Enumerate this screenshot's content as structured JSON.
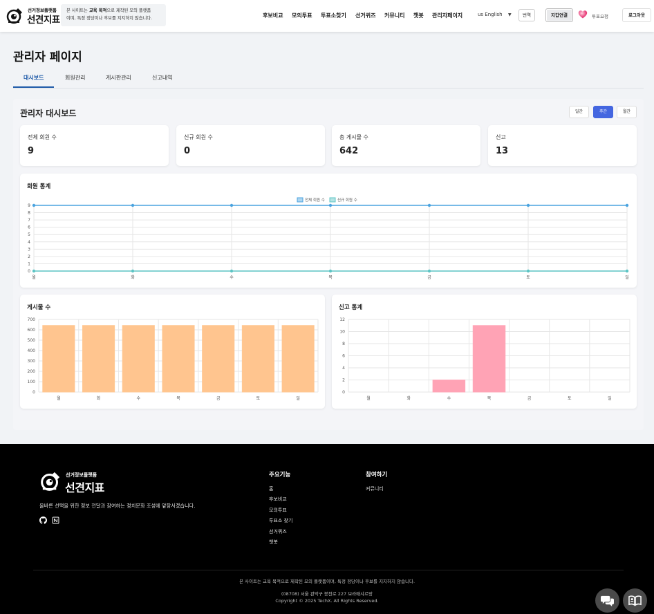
{
  "header": {
    "logo_small": "선거정보플랫폼",
    "logo_big": "선견지표",
    "notice_pre": "본 사이트는 ",
    "notice_bold": "교육 목적",
    "notice_post": "으로 제작된 모의 플랫폼",
    "notice_line2": "이며, 특정 정당이나 후보를 지지하지 않습니다.",
    "nav": [
      "후보비교",
      "모의투표",
      "투표소찾기",
      "선거퀴즈",
      "커뮤니티",
      "챗봇",
      "관리자페이지"
    ],
    "language": "us English",
    "translate_label": "번역",
    "wallet_label": "지갑연결",
    "vote_request_label": "투표요청",
    "logout_label": "로그아웃"
  },
  "page": {
    "title": "관리자 페이지",
    "tabs": [
      "대시보드",
      "회원관리",
      "게시판관리",
      "신고내역"
    ],
    "active_tab": "대시보드"
  },
  "dashboard": {
    "title": "관리자 대시보드",
    "periods": [
      "일간",
      "주간",
      "월간"
    ],
    "active_period": "주간",
    "stats": [
      {
        "label": "전체 회원 수",
        "value": "9"
      },
      {
        "label": "신규 회원 수",
        "value": "0"
      },
      {
        "label": "총 게시물 수",
        "value": "642"
      },
      {
        "label": "신고",
        "value": "13"
      }
    ]
  },
  "charts": {
    "members_title": "회원 통계",
    "posts_title": "게시물 수",
    "reports_title": "신고 통계"
  },
  "chart_data": [
    {
      "type": "line",
      "title": "회원 통계",
      "x": [
        "월",
        "화",
        "수",
        "목",
        "금",
        "토",
        "일"
      ],
      "series": [
        {
          "name": "전체 회원 수",
          "values": [
            9,
            9,
            9,
            9,
            9,
            9,
            9
          ],
          "color": "#4aa3df"
        },
        {
          "name": "신규 회원 수",
          "values": [
            0,
            0,
            0,
            0,
            0,
            0,
            0
          ],
          "color": "#5cc4c4"
        }
      ],
      "ylim": [
        0,
        9
      ],
      "yticks": [
        0,
        1,
        2,
        3,
        4,
        5,
        6,
        7,
        8,
        9
      ],
      "grid": true,
      "legend": "top-center"
    },
    {
      "type": "bar",
      "title": "게시물 수",
      "categories": [
        "월",
        "화",
        "수",
        "목",
        "금",
        "토",
        "일"
      ],
      "values": [
        642,
        642,
        642,
        642,
        642,
        642,
        642
      ],
      "ylim": [
        0,
        700
      ],
      "yticks": [
        0,
        100,
        200,
        300,
        400,
        500,
        600,
        700
      ],
      "color": "#ffc58f",
      "grid": true
    },
    {
      "type": "bar",
      "title": "신고 통계",
      "categories": [
        "월",
        "화",
        "수",
        "목",
        "금",
        "토",
        "일"
      ],
      "values": [
        0,
        0,
        2,
        11,
        0,
        0,
        0
      ],
      "ylim": [
        0,
        12
      ],
      "yticks": [
        0,
        2,
        4,
        6,
        8,
        10,
        12
      ],
      "color": "#ffa3b5",
      "grid": true
    }
  ],
  "footer": {
    "logo_small": "선거정보플랫폼",
    "logo_big": "선견지표",
    "description": "올바른 선택을 위한 정보 전달과 참여하는 정치문화 조성에 앞장서겠습니다.",
    "features_title": "주요기능",
    "features": [
      "홈",
      "후보비교",
      "모의투표",
      "투표소 찾기",
      "선거퀴즈",
      "챗봇"
    ],
    "participate_title": "참여하기",
    "participate": [
      "커뮤니티"
    ],
    "disclaimer": "본 사이트는 교육 목적으로 제작된 모의 플랫폼이며, 특정 정당이나 후보를 지지하지 않습니다.",
    "address": "(08708) 서울 관악구 봉천로 227 보라매샤르망",
    "copyright": "Copyright © 2025 TechX. All Rights Reserved."
  },
  "icons": {
    "github": "github-icon",
    "notion": "notion-icon",
    "chat": "chat-icon",
    "book": "book-icon",
    "heart": "heart-icon",
    "caret": "chevron-down-icon"
  }
}
